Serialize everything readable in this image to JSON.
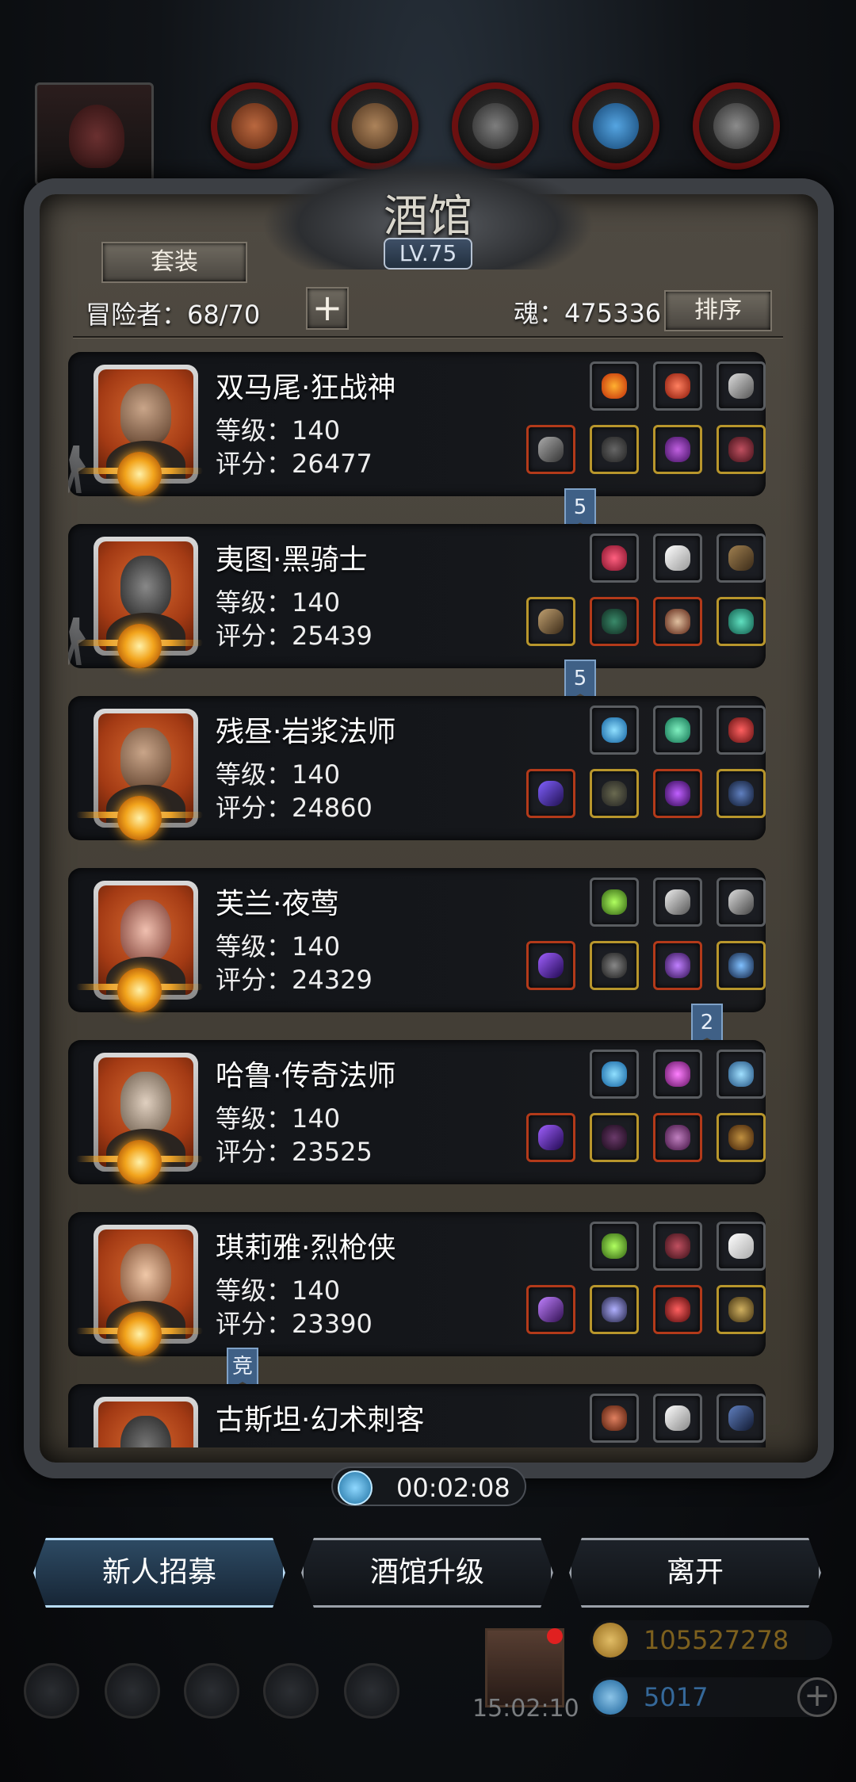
{
  "title": "酒馆",
  "level": "LV.75",
  "buttons": {
    "set": "套装",
    "sort": "排序",
    "add": "+",
    "recruit": "新人招募",
    "upgrade": "酒馆升级",
    "leave": "离开"
  },
  "adventurers": "冒险者：68/70",
  "soul": "魂：475336",
  "timer": "00:02:08",
  "clock": "15:02:10",
  "resources": {
    "gold": "105527278",
    "gems": "5017",
    "plus": "+"
  },
  "colors": {
    "accent_blue": "#6ab4e8",
    "slot_red": "#b33a1a",
    "slot_gold": "#b8962c",
    "portrait_orange": "#d96a30"
  },
  "heroes": [
    {
      "name": "双马尾·狂战神",
      "level": "等级：140",
      "score": "评分：26477",
      "tag": "5"
    },
    {
      "name": "夷图·黑骑士",
      "level": "等级：140",
      "score": "评分：25439",
      "tag": "5"
    },
    {
      "name": "残昼·岩浆法师",
      "level": "等级：140",
      "score": "评分：24860",
      "tag": ""
    },
    {
      "name": "芙兰·夜莺",
      "level": "等级：140",
      "score": "评分：24329",
      "tag": "2"
    },
    {
      "name": "哈鲁·传奇法师",
      "level": "等级：140",
      "score": "评分：23525",
      "tag": ""
    },
    {
      "name": "琪莉雅·烈枪侠",
      "level": "等级：140",
      "score": "评分：23390",
      "tag": "竞"
    },
    {
      "name": "古斯坦·幻术刺客",
      "level": "",
      "score": "",
      "tag": ""
    }
  ]
}
